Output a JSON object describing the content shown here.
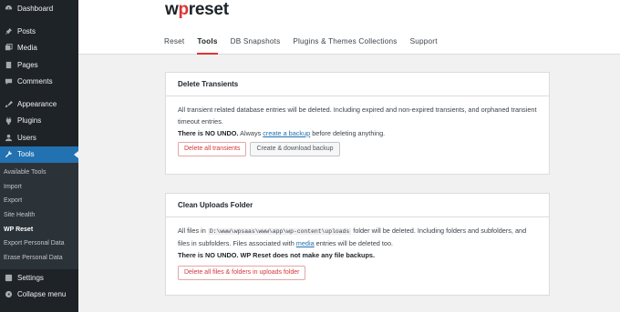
{
  "sidebar": {
    "items": [
      {
        "label": "Dashboard"
      },
      {
        "label": "Posts"
      },
      {
        "label": "Media"
      },
      {
        "label": "Pages"
      },
      {
        "label": "Comments"
      },
      {
        "label": "Appearance"
      },
      {
        "label": "Plugins"
      },
      {
        "label": "Users"
      },
      {
        "label": "Tools"
      },
      {
        "label": "Settings"
      },
      {
        "label": "Collapse menu"
      }
    ],
    "submenu": [
      {
        "label": "Available Tools"
      },
      {
        "label": "Import"
      },
      {
        "label": "Export"
      },
      {
        "label": "Site Health"
      },
      {
        "label": "WP Reset"
      },
      {
        "label": "Export Personal Data"
      },
      {
        "label": "Erase Personal Data"
      }
    ],
    "active_item": "Tools",
    "current_submenu": "WP Reset"
  },
  "header": {
    "logo_prefix": "w",
    "logo_accent": "p",
    "logo_suffix": "reset",
    "tabs": [
      {
        "label": "Reset"
      },
      {
        "label": "Tools"
      },
      {
        "label": "DB Snapshots"
      },
      {
        "label": "Plugins & Themes Collections"
      },
      {
        "label": "Support"
      }
    ],
    "active_tab": "Tools"
  },
  "cards": {
    "transients": {
      "title": "Delete Transients",
      "desc": "All transient related database entries will be deleted. Including expired and non-expired transients, and orphaned transient timeout entries.",
      "warning": "There is NO UNDO.",
      "always": " Always ",
      "link": "create a backup",
      "after": " before deleting anything.",
      "btn_delete": "Delete all transients",
      "btn_backup": "Create & download backup"
    },
    "uploads": {
      "title": "Clean Uploads Folder",
      "desc_pre": "All files in ",
      "path": "D:\\www\\wpsaas\\www\\app\\wp-content\\uploads",
      "desc_mid": " folder will be deleted. Including folders and subfolders, and files in subfolders. Files associated with ",
      "media_link": "media",
      "desc_post": " entries will be deleted too.",
      "warning": "There is NO UNDO. WP Reset does not make any file backups.",
      "btn_delete": "Delete all files & folders in uploads folder"
    }
  },
  "colors": {
    "sidebar_bg": "#1d2327",
    "active_blue": "#2271b1",
    "brand_red": "#dd3333"
  }
}
